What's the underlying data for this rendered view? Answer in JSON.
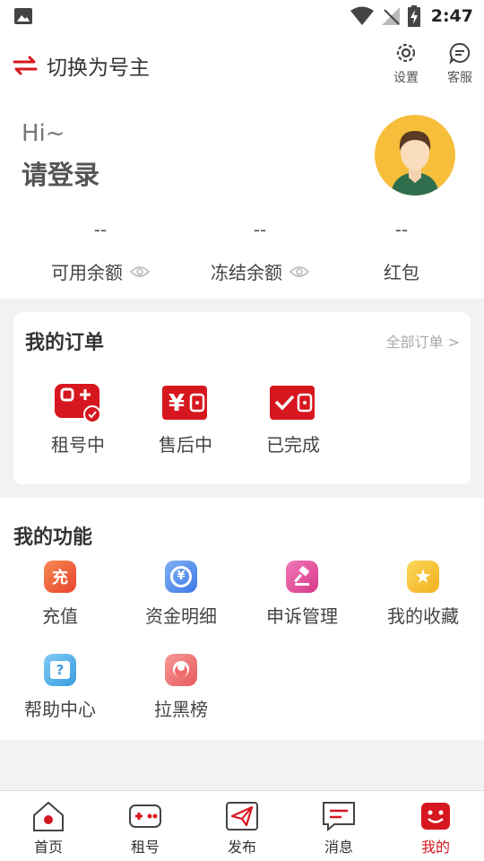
{
  "status_bar": {
    "time": "2:47"
  },
  "header": {
    "switch_label": "切换为号主",
    "settings_label": "设置",
    "service_label": "客服"
  },
  "profile": {
    "greeting": "Hi~",
    "login_prompt": "请登录"
  },
  "stats": [
    {
      "value": "--",
      "label": "可用余额",
      "has_eye": true
    },
    {
      "value": "--",
      "label": "冻结余额",
      "has_eye": true
    },
    {
      "value": "--",
      "label": "红包",
      "has_eye": false
    }
  ],
  "orders": {
    "title": "我的订单",
    "all_label": "全部订单 >",
    "items": [
      {
        "label": "租号中",
        "icon": "gamepad-check-icon"
      },
      {
        "label": "售后中",
        "icon": "yen-wallet-icon"
      },
      {
        "label": "已完成",
        "icon": "check-wallet-icon"
      }
    ]
  },
  "functions": {
    "title": "我的功能",
    "items": [
      {
        "label": "充值",
        "icon": "recharge-icon",
        "glyph": "充",
        "color": "#f0643c"
      },
      {
        "label": "资金明细",
        "icon": "fund-detail-icon",
        "glyph": "¥",
        "color": "#4f8ff0"
      },
      {
        "label": "申诉管理",
        "icon": "gavel-icon",
        "glyph": "",
        "color": "#e84c9a"
      },
      {
        "label": "我的收藏",
        "icon": "star-icon",
        "glyph": "★",
        "color": "#f6c23a"
      },
      {
        "label": "帮助中心",
        "icon": "help-icon",
        "glyph": "?",
        "color": "#4aa8e8"
      },
      {
        "label": "拉黑榜",
        "icon": "blacklist-icon",
        "glyph": "",
        "color": "#f06a6a"
      }
    ]
  },
  "tabs": [
    {
      "label": "首页",
      "icon": "home-icon",
      "active": false
    },
    {
      "label": "租号",
      "icon": "gamepad-icon",
      "active": false
    },
    {
      "label": "发布",
      "icon": "send-icon",
      "active": false
    },
    {
      "label": "消息",
      "icon": "message-icon",
      "active": false
    },
    {
      "label": "我的",
      "icon": "smile-icon",
      "active": true
    }
  ],
  "colors": {
    "accent": "#d6171f"
  }
}
